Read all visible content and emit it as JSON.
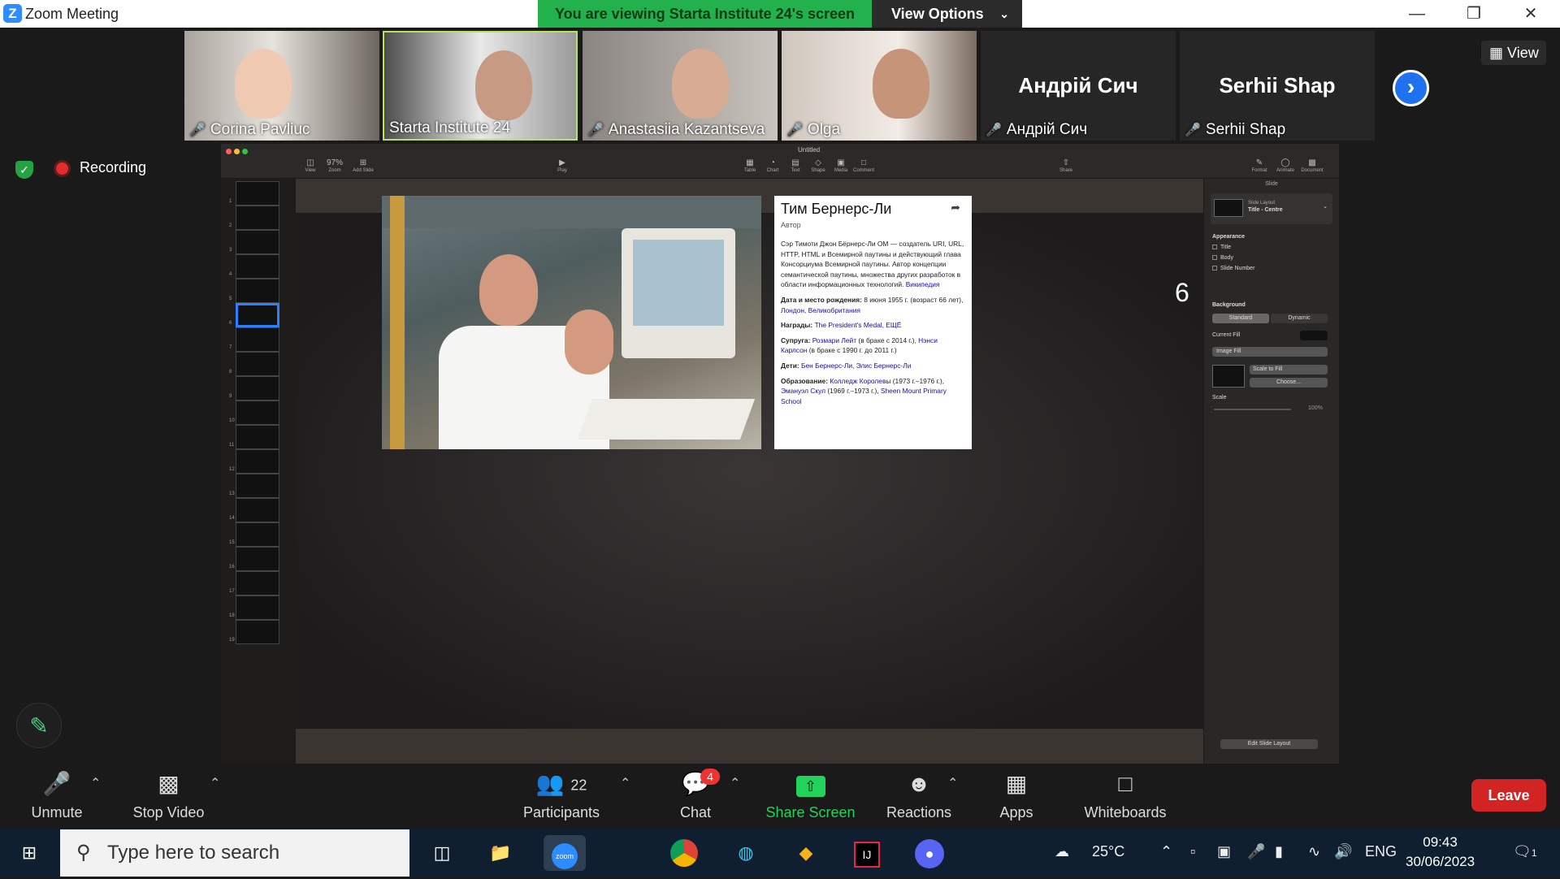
{
  "window": {
    "app_title": "Zoom Meeting",
    "logo": "Z"
  },
  "banner": {
    "viewing": "You are viewing Starta Institute 24's screen",
    "view_options": "View Options"
  },
  "participants_strip": [
    {
      "name": "Corina Pavliuc",
      "muted": true
    },
    {
      "name": "Starta Institute 24",
      "muted": false,
      "active": true
    },
    {
      "name": "Anastasiia Kazantseva",
      "muted": true
    },
    {
      "name": "Olga",
      "muted": true
    },
    {
      "name": "Андрій Сич",
      "big": "Андрій Сич",
      "muted": true
    },
    {
      "name": "Serhii Shap",
      "big": "Serhii Shap",
      "muted": true
    }
  ],
  "view_button": "View",
  "recording": "Recording",
  "keynote": {
    "doc_title": "Untitled",
    "toolbar": [
      "View",
      "Zoom",
      "Add Slide",
      "Play",
      "Table",
      "Chart",
      "Text",
      "Shape",
      "Media",
      "Comment",
      "Share",
      "Format",
      "Animate",
      "Document"
    ],
    "zoom": "97%",
    "slide_numbers": [
      "1",
      "2",
      "3",
      "4",
      "5",
      "6",
      "7",
      "8",
      "9",
      "10",
      "11",
      "12",
      "13",
      "14",
      "15",
      "16",
      "17",
      "18",
      "19"
    ],
    "selected_slide": "6",
    "slide_number_display": "6",
    "inspector": {
      "tab": "Slide",
      "layout_label": "Slide Layout",
      "layout_value": "Title - Centre",
      "appearance": "Appearance",
      "checks": [
        "Title",
        "Body",
        "Slide Number"
      ],
      "background": "Background",
      "bg_standard": "Standard",
      "bg_dynamic": "Dynamic",
      "current_fill": "Current Fill",
      "image_fill": "Image Fill",
      "scale_to_fill": "Scale to Fill",
      "choose": "Choose...",
      "scale": "Scale",
      "scale_value": "100%",
      "edit_layout": "Edit Slide Layout"
    }
  },
  "card": {
    "title": "Тим Бернерс-Ли",
    "subtitle": "Автор",
    "desc": "Сэр Тимоти Джон Бёрнерс-Ли OM — создатель URI, URL, HTTP, HTML и Всемирной паутины и действующий глава Консорциума Всемирной паутины. Автор концепции семантической паутины, множества других разработок в области информационных технологий.",
    "desc_link": "Википедия",
    "born_label": "Дата и место рождения:",
    "born_text": "8 июня 1955 г. (возраст 66 лет),",
    "born_link": "Лондон, Великобритания",
    "awards_label": "Награды:",
    "awards_link": "The President's Medal, ЕЩЁ",
    "spouse_label": "Супруга:",
    "spouse_link1": "Розмари Лейт",
    "spouse_text1": "(в браке с 2014 г.),",
    "spouse_link2": "Нэнси Карлсон",
    "spouse_text2": "(в браке с 1990 г. до 2011 г.)",
    "kids_label": "Дети:",
    "kids_link": "Бен Бернерс-Ли, Элис Бернерс-Ли",
    "edu_label": "Образование:",
    "edu_link1": "Колледж Королевы",
    "edu_text1": "(1973 г.–1976 г.),",
    "edu_link2": "Эмануэл Скул",
    "edu_text2": "(1969 г.–1973 г.),",
    "edu_link3": "Sheen Mount Primary School"
  },
  "toolbar": {
    "unmute": "Unmute",
    "stop_video": "Stop Video",
    "participants": "Participants",
    "participants_count": "22",
    "chat": "Chat",
    "chat_badge": "4",
    "share_screen": "Share Screen",
    "reactions": "Reactions",
    "apps": "Apps",
    "whiteboards": "Whiteboards",
    "leave": "Leave"
  },
  "taskbar": {
    "search_placeholder": "Type here to search",
    "weather": "25°C",
    "lang": "ENG",
    "time": "09:43",
    "date": "30/06/2023",
    "notifications": "1"
  },
  "colors": {
    "zoom_blue": "#2d8cff",
    "banner_green": "#23b14d",
    "leave_red": "#d32424",
    "share_green": "#23d25a"
  }
}
